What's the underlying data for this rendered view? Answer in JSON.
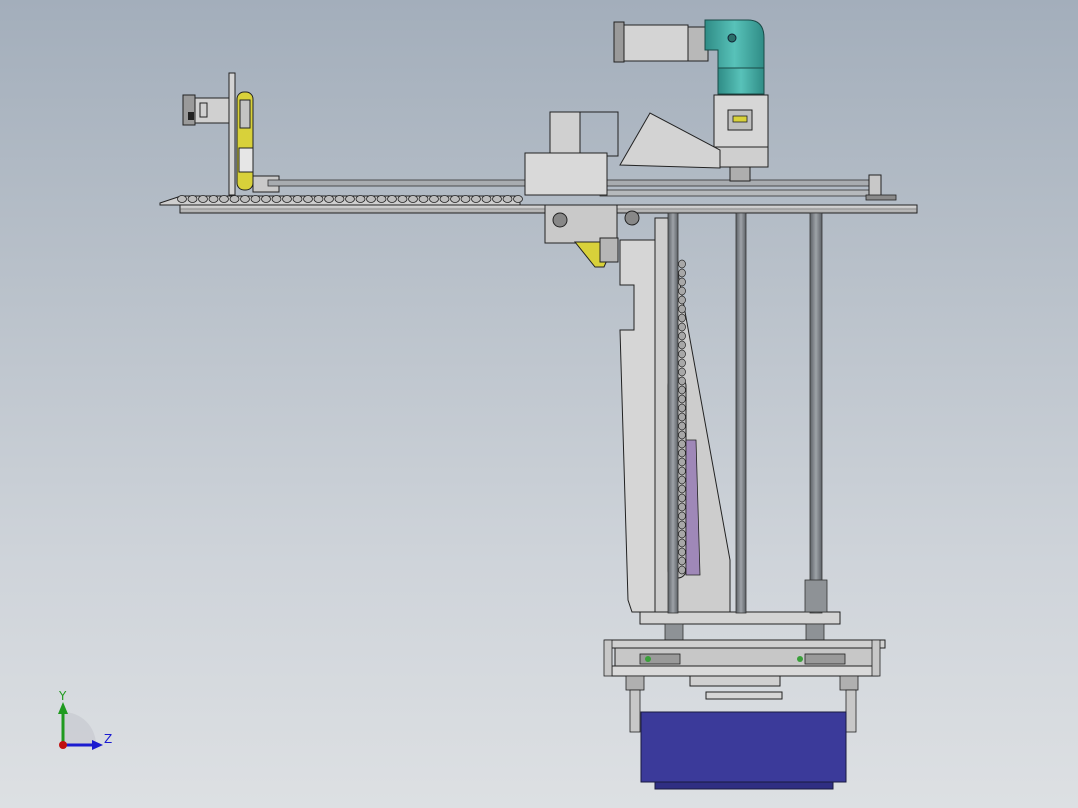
{
  "viewport": {
    "name": "solidworks-graphics-area",
    "background_top": "#a3aebb",
    "background_bottom": "#dde0e3"
  },
  "model": {
    "name": "gantry-robot-assembly",
    "components": [
      "servo-motor-vertical",
      "right-angle-gearbox",
      "servo-motor-horizontal",
      "belt-drive",
      "horizontal-beam",
      "drag-chain",
      "carriage",
      "vertical-column",
      "guide-rods",
      "gripper-head",
      "workpiece"
    ],
    "colors": {
      "metal": "#c8c8c8",
      "metal_dark": "#7d8186",
      "edge": "#2b2b2b",
      "gearbox": "#3ea8a0",
      "belt_yellow": "#d8d13a",
      "workpiece": "#3b3a9a",
      "accent_purple": "#9f88b8"
    }
  },
  "triad": {
    "y_label": "Y",
    "z_label": "Z",
    "y_color": "#1f9a1f",
    "z_color": "#1b1bd0",
    "x_color": "#c01010"
  }
}
